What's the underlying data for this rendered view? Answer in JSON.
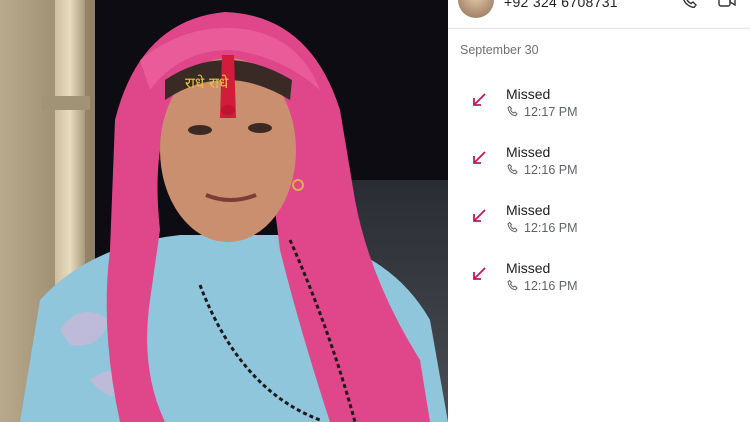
{
  "contact": {
    "number": "+92 324 6708731"
  },
  "call_log": {
    "date_header": "September 30",
    "entries": [
      {
        "status": "Missed",
        "time": "12:17 PM"
      },
      {
        "status": "Missed",
        "time": "12:16 PM"
      },
      {
        "status": "Missed",
        "time": "12:16 PM"
      },
      {
        "status": "Missed",
        "time": "12:16 PM"
      }
    ]
  },
  "colors": {
    "missed_arrow": "#c2185b",
    "header_text": "#202124",
    "secondary_text": "#5f6368"
  },
  "icons": {
    "call": "phone-icon",
    "video": "video-icon",
    "missed": "missed-call-arrow-icon",
    "entry_type": "phone-small-icon"
  }
}
